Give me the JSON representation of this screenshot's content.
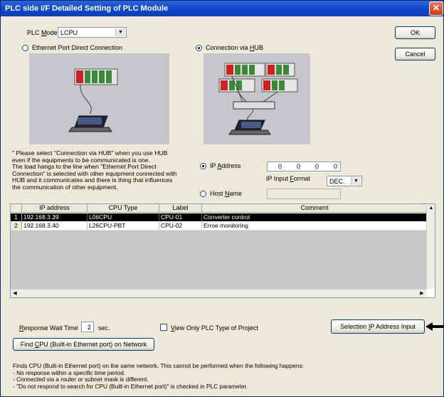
{
  "window": {
    "title": "PLC side I/F Detailed Setting of PLC Module"
  },
  "plc_mode": {
    "label_pre": "PLC ",
    "label_key": "M",
    "label_post": "ode",
    "value": "LCPU"
  },
  "buttons": {
    "ok": "OK",
    "cancel": "Cancel"
  },
  "connection": {
    "direct_label": "Ethernet Port Direct Connection",
    "hub_label_pre": "Connection via ",
    "hub_label_key": "H",
    "hub_label_post": "UB",
    "selected": "hub"
  },
  "note_lines": [
    "\" Please select \"Connection via HUB\" when you use HUB",
    "even if the equipments to be communicated is one.",
    "The load hangs to the line when \"Ethernet Port Direct",
    "Connection\" is selected with other equipment connected with",
    "HUB and it communicates and there is thing that influences",
    "the communication of other equipment."
  ],
  "ip": {
    "ip_label_pre": "IP ",
    "ip_label_key": "A",
    "ip_label_post": "ddress",
    "octets": [
      "0",
      "0",
      "0",
      "0"
    ],
    "format_label_pre": "IP Input ",
    "format_label_key": "F",
    "format_label_post": "ormat",
    "format_value": "DEC.",
    "host_label_pre": "Host ",
    "host_label_key": "N",
    "host_label_post": "ame"
  },
  "table": {
    "columns": [
      "IP address",
      "CPU Type",
      "Label",
      "Comment"
    ],
    "rows": [
      {
        "num": "1",
        "ip": "192.168.3.39",
        "cpu": "L06CPU",
        "label": "CPU-01",
        "comment": "Converter control"
      },
      {
        "num": "2",
        "ip": "192.168.3.40",
        "cpu": "L26CPU-PBT",
        "label": "CPU-02",
        "comment": "Erroe monitoring"
      }
    ]
  },
  "response": {
    "label_key": "R",
    "label_post": "esponse Wait Time",
    "value": "2",
    "unit": "sec."
  },
  "view_only": {
    "label_key": "V",
    "label_post": "iew Only PLC Type of Project"
  },
  "selection_button": {
    "pre": "Selection ",
    "key": "I",
    "post": "P Address Input"
  },
  "find_button": {
    "pre": "Find ",
    "key": "C",
    "post": "PU (Built-in Ethernet port) on Network"
  },
  "find_notes": [
    "Finds CPU (Built-in Ethernet port) on the same network. This cannot be performed when the following happens:",
    "- No response within a specific time period.",
    "- Connected via a router or subnet mask is different.",
    "- \"Do not respond to search for CPU (Built-in Ethernet port)\" is checked in PLC parameter."
  ]
}
